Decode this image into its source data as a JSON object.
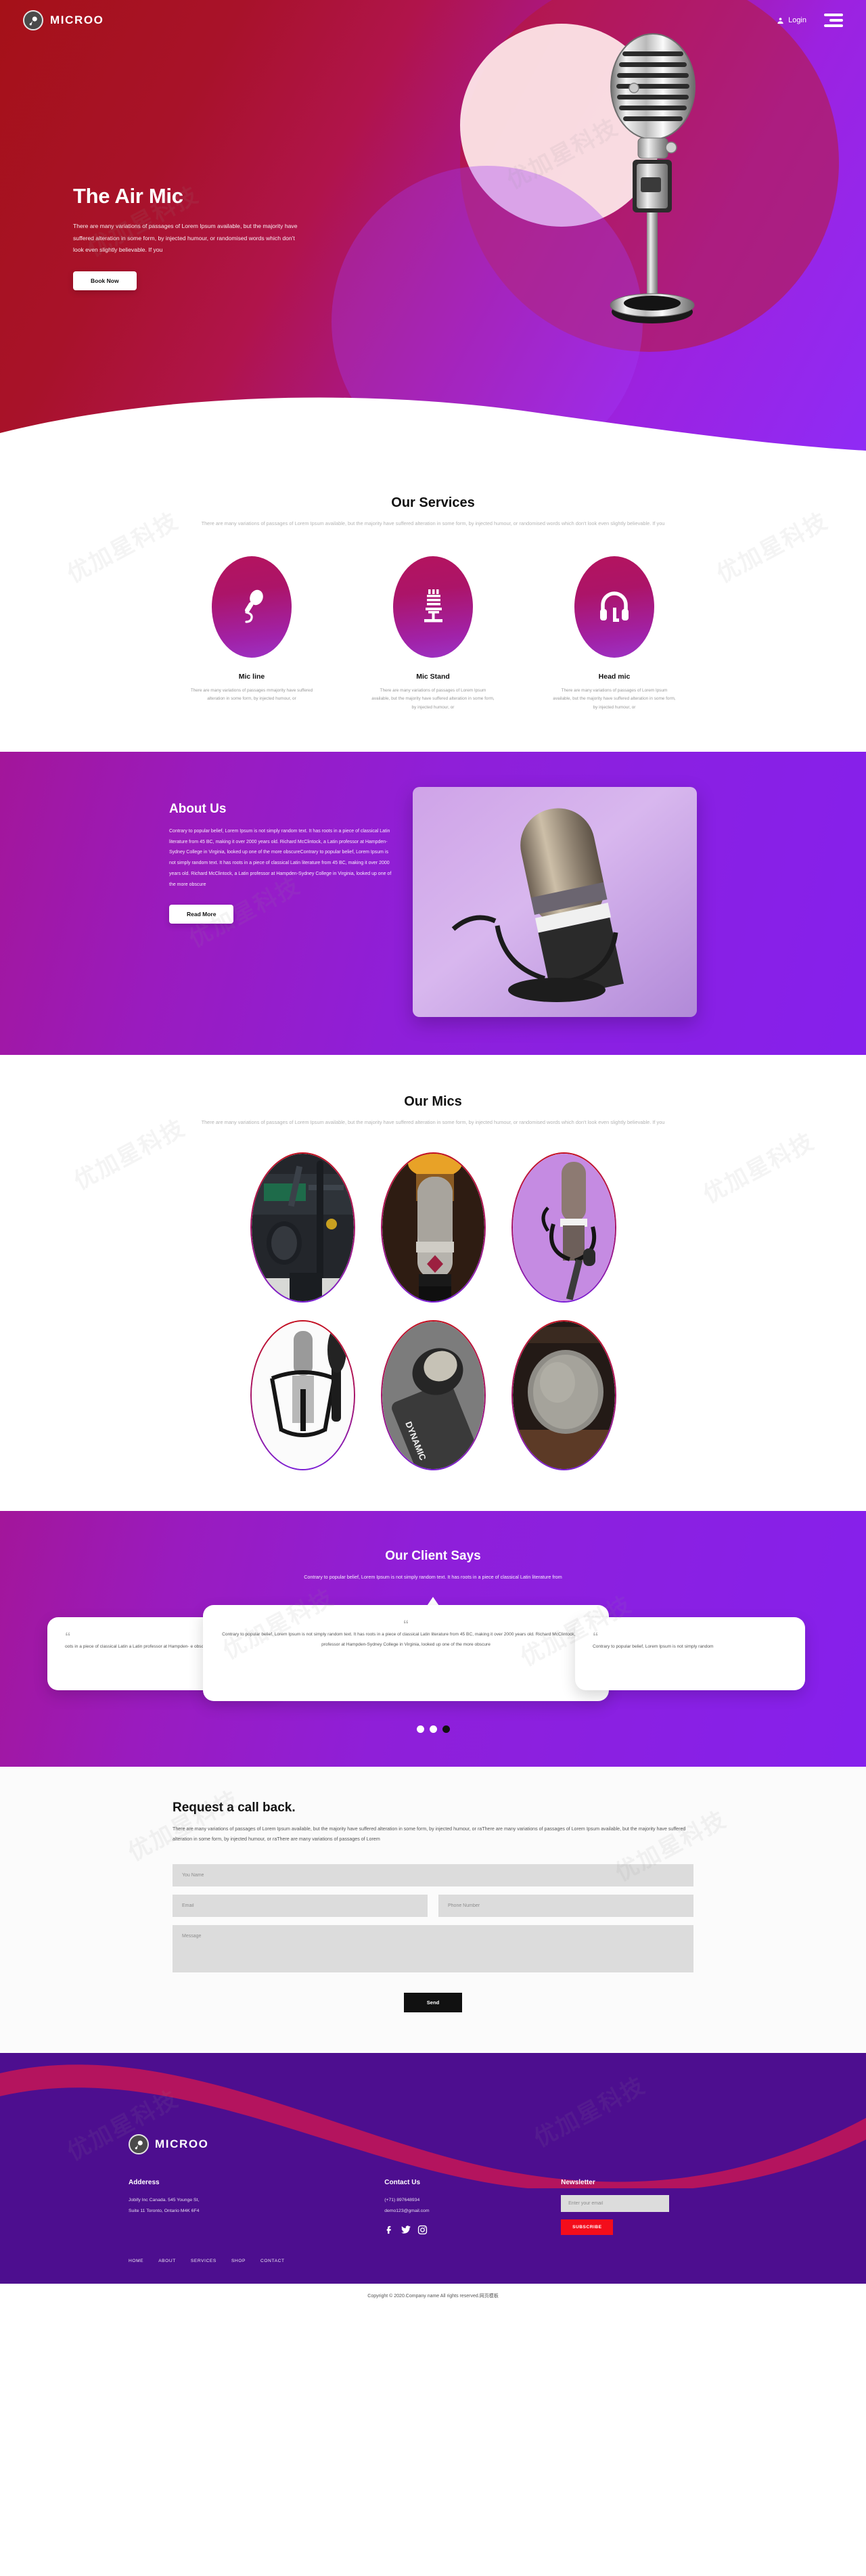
{
  "header": {
    "brand": "MICROO",
    "login_label": "Login",
    "login_icon": "user-icon",
    "menu_icon": "hamburger-icon"
  },
  "hero": {
    "title": "The Air Mic",
    "text": "There are many variations of passages of Lorem Ipsum available, but the majority have suffered alteration in some form, by injected humour, or randomised words which don't look even slightly believable. If you",
    "cta_label": "Book Now"
  },
  "services": {
    "title": "Our Services",
    "subtitle": "There are many variations of passages of Lorem Ipsum available, but the majority have suffered alteration in some form, by injected humour, or randomised words which don't look even slightly believable. If you",
    "items": [
      {
        "icon": "handheld-mic-icon",
        "name": "Mic line",
        "text": "There are many variations of passages mmajority have suffered alteration in some form, by injected humour, or"
      },
      {
        "icon": "mic-stand-icon",
        "name": "Mic Stand",
        "text": "There are many variations of passages of Lorem Ipsum available, but the majority have suffered alteration in some form, by injected humour, or"
      },
      {
        "icon": "headset-icon",
        "name": "Head mic",
        "text": "There are many variations of passages of Lorem Ipsum available, but the majority have suffered alteration in some form, by injected humour, or"
      }
    ]
  },
  "about": {
    "title": "About Us",
    "text": "Contrary to popular belief, Lorem Ipsum is not simply random text. It has roots in a piece of classical Latin literature from 45 BC, making it over 2000 years old. Richard McClintock, a Latin professor at Hampden-Sydney College in Virginia, looked up one of the more obscureContrary to popular belief, Lorem Ipsum is not simply random text. It has roots in a piece of classical Latin literature from 45 BC, making it over 2000 years old. Richard McClintock, a Latin professor at Hampden-Sydney College in Virginia, looked up one of the more obscure",
    "cta_label": "Read More"
  },
  "mics": {
    "title": "Our Mics",
    "subtitle": "There are many variations of passages of Lorem Ipsum available, but the majority have suffered alteration in some form, by injected humour, or randomised words which don't look even slightly believable. If you"
  },
  "testimonials": {
    "title": "Our Client Says",
    "subtitle": "Contrary to popular belief, Lorem Ipsum is not simply random text. It has roots in a piece of classical Latin literature from",
    "left_text": "oots in a piece of classical Latin a Latin professor at Hampden- e obscure",
    "center_text": "Contrary to popular belief, Lorem Ipsum is not simply random text. It has roots in a piece of classical Latin literature from 45 BC, making it over 2000 years old. Richard McClintock, a Latin professor at Hampden-Sydney College in Virginia, looked up one of the more obscure",
    "right_text": "Contrary to popular belief, Lorem Ipsum is not simply random",
    "quote_open": "“",
    "quote_close": "”",
    "dots": 3,
    "active_dot": 3
  },
  "callback": {
    "title": "Request a call back.",
    "text": "There are many variations of passages of Lorem Ipsum available, but the majority have suffered alteration in some form, by injected humour, or raThere are many variations of passages of Lorem Ipsum available, but the majority have suffered alteration in some form, by injected humour, or raThere are many variations of passages of Lorem",
    "name_placeholder": "You Name",
    "email_placeholder": "Email",
    "phone_placeholder": "Phone Number",
    "message_placeholder": "Message",
    "submit_label": "Send"
  },
  "footer": {
    "brand": "MICROO",
    "address_heading": "Adderess",
    "address_line1": "Jobify Inc Canada. 545 Younge St,",
    "address_line2": "Suite 11 Toronto, Ontario M4K 6F4",
    "contact_heading": "Contact Us",
    "phone": "(+71) 897648934",
    "email": "demo123@gmail.com",
    "socials": [
      "facebook-icon",
      "twitter-icon",
      "instagram-icon"
    ],
    "newsletter_heading": "Newsletter",
    "newsletter_placeholder": "Enter your email",
    "subscribe_label": "SUBSCRIBE",
    "nav": [
      "HOME",
      "ABOUT",
      "SERVICES",
      "SHOP",
      "CONTACT"
    ],
    "copyright": "Copyright © 2020.Company name All rights reserved.网页模板"
  },
  "colors": {
    "crimson": "#b4145e",
    "purple": "#8620ec",
    "deep_purple": "#4d0e8f",
    "red_accent": "#f40d1b"
  }
}
